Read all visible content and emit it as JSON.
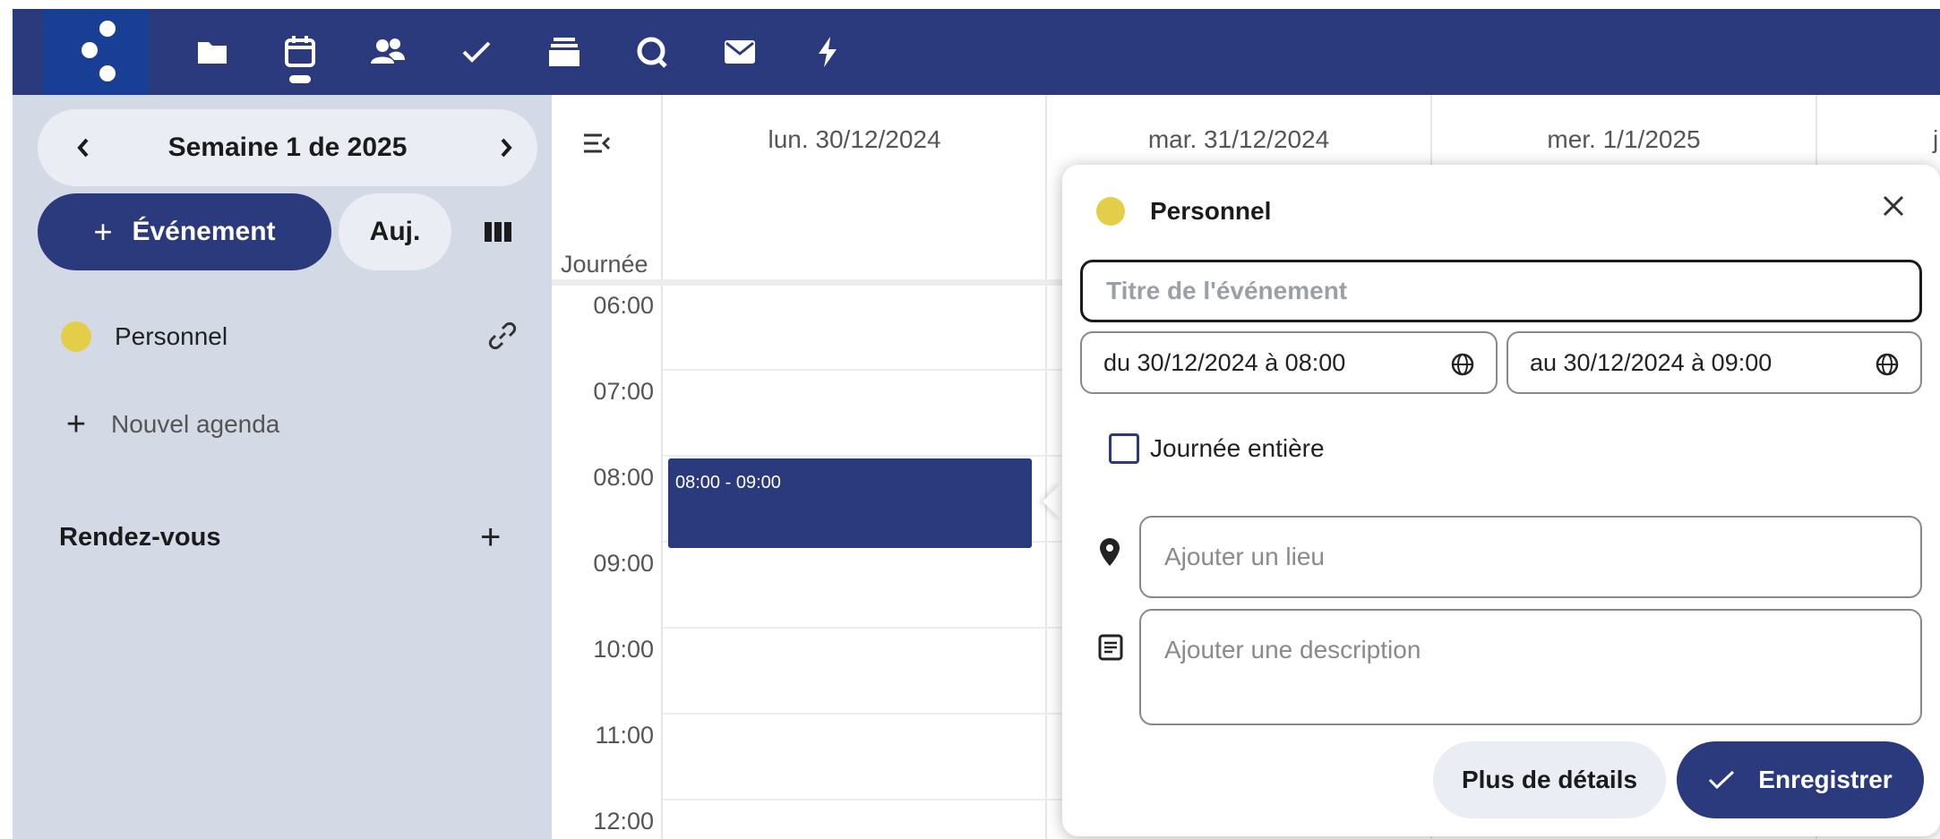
{
  "topbar": {
    "apps": [
      {
        "name": "files",
        "icon": "folder-icon"
      },
      {
        "name": "calendar",
        "icon": "calendar-icon"
      },
      {
        "name": "contacts",
        "icon": "contacts-icon"
      },
      {
        "name": "tasks",
        "icon": "check-icon"
      },
      {
        "name": "deck",
        "icon": "stack-icon"
      },
      {
        "name": "talk",
        "icon": "talk-icon"
      },
      {
        "name": "mail",
        "icon": "mail-icon"
      },
      {
        "name": "activity",
        "icon": "lightning-icon"
      }
    ],
    "active_app": "calendar"
  },
  "sidebar": {
    "week_label": "Semaine 1 de 2025",
    "new_event_label": "Événement",
    "today_label": "Auj.",
    "calendars": [
      {
        "name": "Personnel",
        "color": "#e4cd48"
      }
    ],
    "new_agenda_label": "Nouvel agenda",
    "appointments_label": "Rendez-vous"
  },
  "calendar": {
    "days": [
      "lun. 30/12/2024",
      "mar. 31/12/2024",
      "mer. 1/1/2025"
    ],
    "cut_day_fragment": "j",
    "all_day_label": "Journée entière",
    "all_day_visible": "Journée",
    "hours": [
      "06:00",
      "07:00",
      "08:00",
      "09:00",
      "10:00",
      "11:00",
      "12:00"
    ],
    "event": {
      "time": "08:00 - 09:00"
    }
  },
  "popover": {
    "calendar_name": "Personnel",
    "title_placeholder": "Titre de l'événement",
    "start": "du 30/12/2024 à 08:00",
    "end": "au 30/12/2024 à 09:00",
    "all_day_label": "Journée entière",
    "location_placeholder": "Ajouter un lieu",
    "description_placeholder": "Ajouter une description",
    "more_details_label": "Plus de détails",
    "save_label": "Enregistrer"
  },
  "colors": {
    "primary": "#2b3a7c",
    "sidebar_bg": "#d4d9e6",
    "calendar_personal": "#e4cd48"
  }
}
